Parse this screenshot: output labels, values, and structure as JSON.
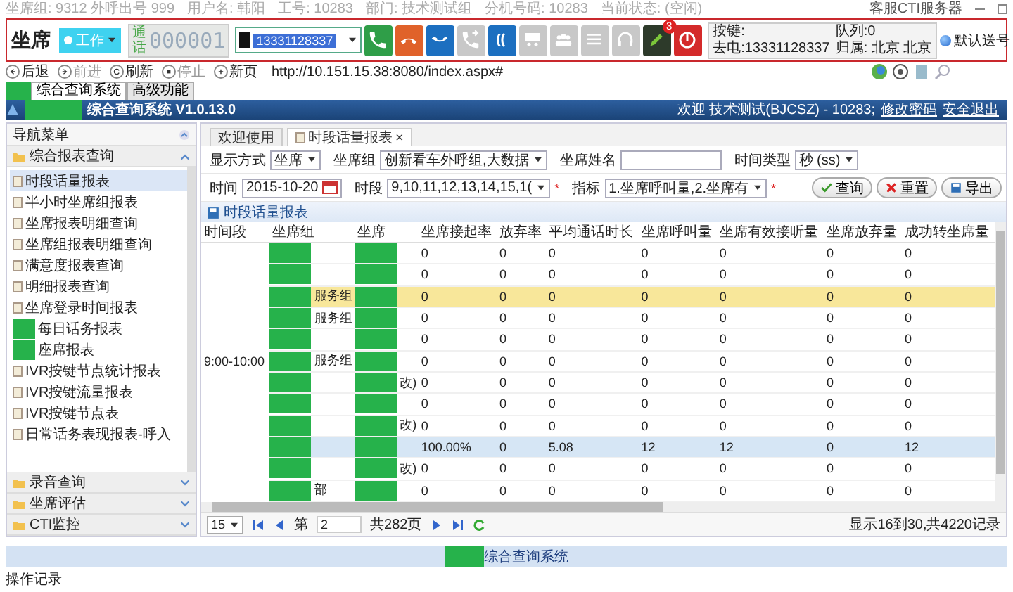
{
  "top_line": {
    "items": [
      "坐席组: 9312 外呼出号 999",
      "用户名: 韩阳",
      "工号: 10283",
      "部门: 技术测试组",
      "分机号码: 10283",
      "当前状态: (空闲)"
    ],
    "server": "客服CTI服务器"
  },
  "toolbar": {
    "title": "坐席",
    "status_button": "工作",
    "call_label": "通话",
    "counter": "000001",
    "number_select": "13331128337",
    "call_buttons": [
      {
        "kind": "answer",
        "disabled": false
      },
      {
        "kind": "hangup",
        "disabled": false
      },
      {
        "kind": "hold",
        "disabled": false
      },
      {
        "kind": "transfer",
        "disabled": true
      },
      {
        "kind": "consult",
        "disabled": false
      },
      {
        "kind": "meeting",
        "disabled": true
      },
      {
        "kind": "group",
        "disabled": true
      },
      {
        "kind": "keypad",
        "disabled": true
      },
      {
        "kind": "headset",
        "disabled": true
      },
      {
        "kind": "note",
        "disabled": false,
        "badge": "3"
      },
      {
        "kind": "power",
        "disabled": false
      }
    ],
    "info": {
      "key_label": "按键:",
      "queue": "队列:0",
      "outgoing": "去电:13331128337",
      "location": "归属: 北京 北京"
    },
    "default_number": "默认送号"
  },
  "browser": {
    "nav": [
      {
        "kind": "back",
        "label": "后退",
        "disabled": false
      },
      {
        "kind": "forward",
        "label": "前进",
        "disabled": true
      },
      {
        "kind": "refresh",
        "label": "刷新",
        "disabled": false
      },
      {
        "kind": "stop",
        "label": "停止",
        "disabled": true
      },
      {
        "kind": "new",
        "label": "新页",
        "disabled": false
      }
    ],
    "url": "http://10.151.15.38:8080/index.aspx#"
  },
  "app_tabs": [
    {
      "label": "综合查询系统",
      "selected": true
    },
    {
      "label": "高级功能",
      "selected": false
    }
  ],
  "header": {
    "title": "综合查询系统 V1.0.13.0",
    "welcome": "欢迎 技术测试(BJCSZ) - 10283;",
    "links": [
      "修改密码",
      "安全退出"
    ]
  },
  "sidebar": {
    "title": "导航菜单",
    "sections": [
      {
        "label": "综合报表查询",
        "expanded": true,
        "items": [
          {
            "label": "时段话量报表",
            "selected": true
          },
          {
            "label": "半小时坐席组报表",
            "selected": false
          },
          {
            "label": "坐席报表明细查询",
            "selected": false
          },
          {
            "label": "坐席组报表明细查询",
            "selected": false
          },
          {
            "label": "满意度报表查询",
            "selected": false
          },
          {
            "label": "明细报表查询",
            "selected": false
          },
          {
            "label": "坐席登录时间报表",
            "selected": false
          },
          {
            "label": "每日话务报表",
            "selected": false,
            "redacted": true
          },
          {
            "label": "座席报表",
            "selected": false,
            "redacted": true
          },
          {
            "label": "IVR按键节点统计报表",
            "selected": false
          },
          {
            "label": "IVR按键流量报表",
            "selected": false
          },
          {
            "label": "IVR按键节点表",
            "selected": false
          },
          {
            "label": "日常话务表现报表-呼入",
            "selected": false
          }
        ]
      },
      {
        "label": "录音查询",
        "expanded": false
      },
      {
        "label": "坐席评估",
        "expanded": false
      },
      {
        "label": "CTI监控",
        "expanded": false
      }
    ]
  },
  "content_tabs": [
    {
      "label": "欢迎使用",
      "selected": false
    },
    {
      "label": "时段话量报表",
      "selected": true,
      "close": "×"
    }
  ],
  "filters": {
    "rows": [
      [
        {
          "label": "显示方式",
          "kind": "select",
          "value": "坐席"
        },
        {
          "label": "坐席组",
          "kind": "select",
          "value": "创新看车外呼组,大数据"
        },
        {
          "label": "坐席姓名",
          "kind": "text"
        },
        {
          "label": "时间类型",
          "kind": "select",
          "value": "秒 (ss)"
        }
      ],
      [
        {
          "label": "时间",
          "kind": "date",
          "value": "2015-10-20"
        },
        {
          "label": "时段",
          "kind": "select",
          "value": "9,10,11,12,13,14,15,1(",
          "note": "*"
        },
        {
          "label": "指标",
          "kind": "select",
          "value": "1.坐席呼叫量,2.坐席有",
          "note": "*"
        }
      ]
    ],
    "buttons": [
      {
        "kind": "search",
        "label": "查询"
      },
      {
        "kind": "reset",
        "label": "重置"
      },
      {
        "kind": "export",
        "label": "导出"
      }
    ]
  },
  "report": {
    "title": "时段话量报表",
    "columns": [
      "时间段",
      "坐席组",
      "坐席",
      "坐席接起率",
      "放弃率",
      "平均通话时长",
      "坐席呼叫量",
      "坐席有效接听量",
      "坐席放弃量",
      "成功转坐席量"
    ],
    "time_slot": "9:00-10:00",
    "rows": [
      {
        "values": [
          "0",
          "0",
          "0",
          "0",
          "0",
          "0",
          "0"
        ],
        "selected": false,
        "hovered": false
      },
      {
        "values": [
          "0",
          "0",
          "0",
          "0",
          "0",
          "0",
          "0"
        ],
        "selected": false,
        "hovered": false
      },
      {
        "group": "服务组",
        "values": [
          "0",
          "0",
          "0",
          "0",
          "0",
          "0",
          "0"
        ],
        "selected": false,
        "hovered": true
      },
      {
        "group": "服务组",
        "values": [
          "0",
          "0",
          "0",
          "0",
          "0",
          "0",
          "0"
        ],
        "selected": false,
        "hovered": false
      },
      {
        "values": [
          "0",
          "0",
          "0",
          "0",
          "0",
          "0",
          "0"
        ],
        "selected": false,
        "hovered": false
      },
      {
        "group": "服务组",
        "values": [
          "0",
          "0",
          "0",
          "0",
          "0",
          "0",
          "0"
        ],
        "selected": false,
        "hovered": false
      },
      {
        "agent": "改)",
        "values": [
          "0",
          "0",
          "0",
          "0",
          "0",
          "0",
          "0"
        ],
        "selected": false,
        "hovered": false
      },
      {
        "values": [
          "0",
          "0",
          "0",
          "0",
          "0",
          "0",
          "0"
        ],
        "selected": false,
        "hovered": false
      },
      {
        "agent": "改)",
        "values": [
          "0",
          "0",
          "0",
          "0",
          "0",
          "0",
          "0"
        ],
        "selected": false,
        "hovered": false
      },
      {
        "values": [
          "100.00%",
          "0",
          "5.08",
          "12",
          "12",
          "0",
          "12"
        ],
        "selected": true,
        "hovered": false
      },
      {
        "agent": "改)",
        "values": [
          "0",
          "0",
          "0",
          "0",
          "0",
          "0",
          "0"
        ],
        "selected": false,
        "hovered": false
      },
      {
        "group": "部",
        "values": [
          "0",
          "0",
          "0",
          "0",
          "0",
          "0",
          "0"
        ],
        "selected": false,
        "hovered": false
      }
    ]
  },
  "pager": {
    "page_size": "15",
    "page_prefix": "第",
    "page": "2",
    "total_pages": "共282页",
    "summary": "显示16到30,共4220记录"
  },
  "footer": {
    "title": "综合查询系统",
    "status": "操作记录"
  }
}
